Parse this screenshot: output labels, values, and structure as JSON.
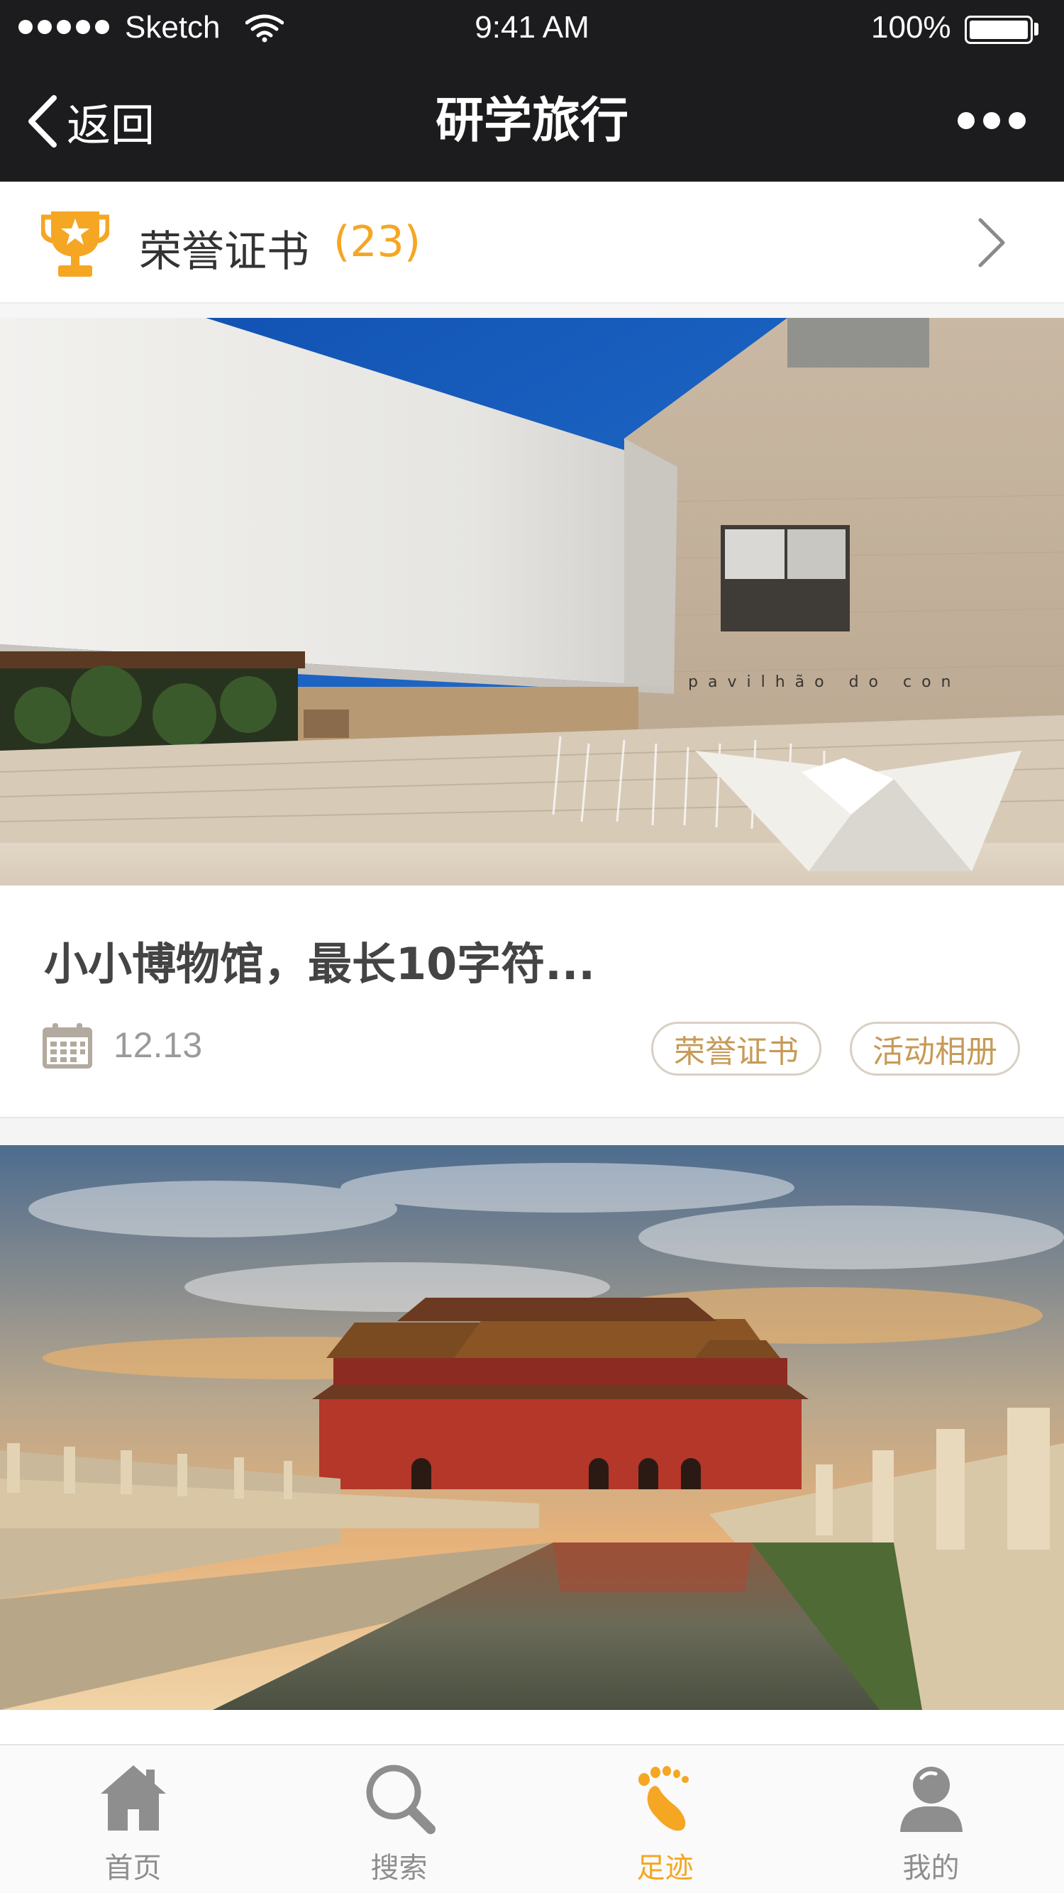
{
  "status_bar": {
    "carrier": "Sketch",
    "time": "9:41 AM",
    "battery": "100%"
  },
  "nav": {
    "back_label": "返回",
    "title": "研学旅行"
  },
  "honor": {
    "label": "荣誉证书",
    "count": "(23)"
  },
  "cards": [
    {
      "title": "小小博物馆，最长10字符...",
      "date": "12.13",
      "tags": [
        "荣誉证书",
        "活动相册"
      ]
    }
  ],
  "tabbar": {
    "items": [
      {
        "label": "首页",
        "icon": "home-icon"
      },
      {
        "label": "搜索",
        "icon": "search-icon"
      },
      {
        "label": "足迹",
        "icon": "footprint-icon",
        "active": true
      },
      {
        "label": "我的",
        "icon": "user-icon"
      }
    ]
  },
  "colors": {
    "accent": "#f5a623",
    "tag_text": "#c79a56",
    "topbar": "#1c1c1e"
  }
}
